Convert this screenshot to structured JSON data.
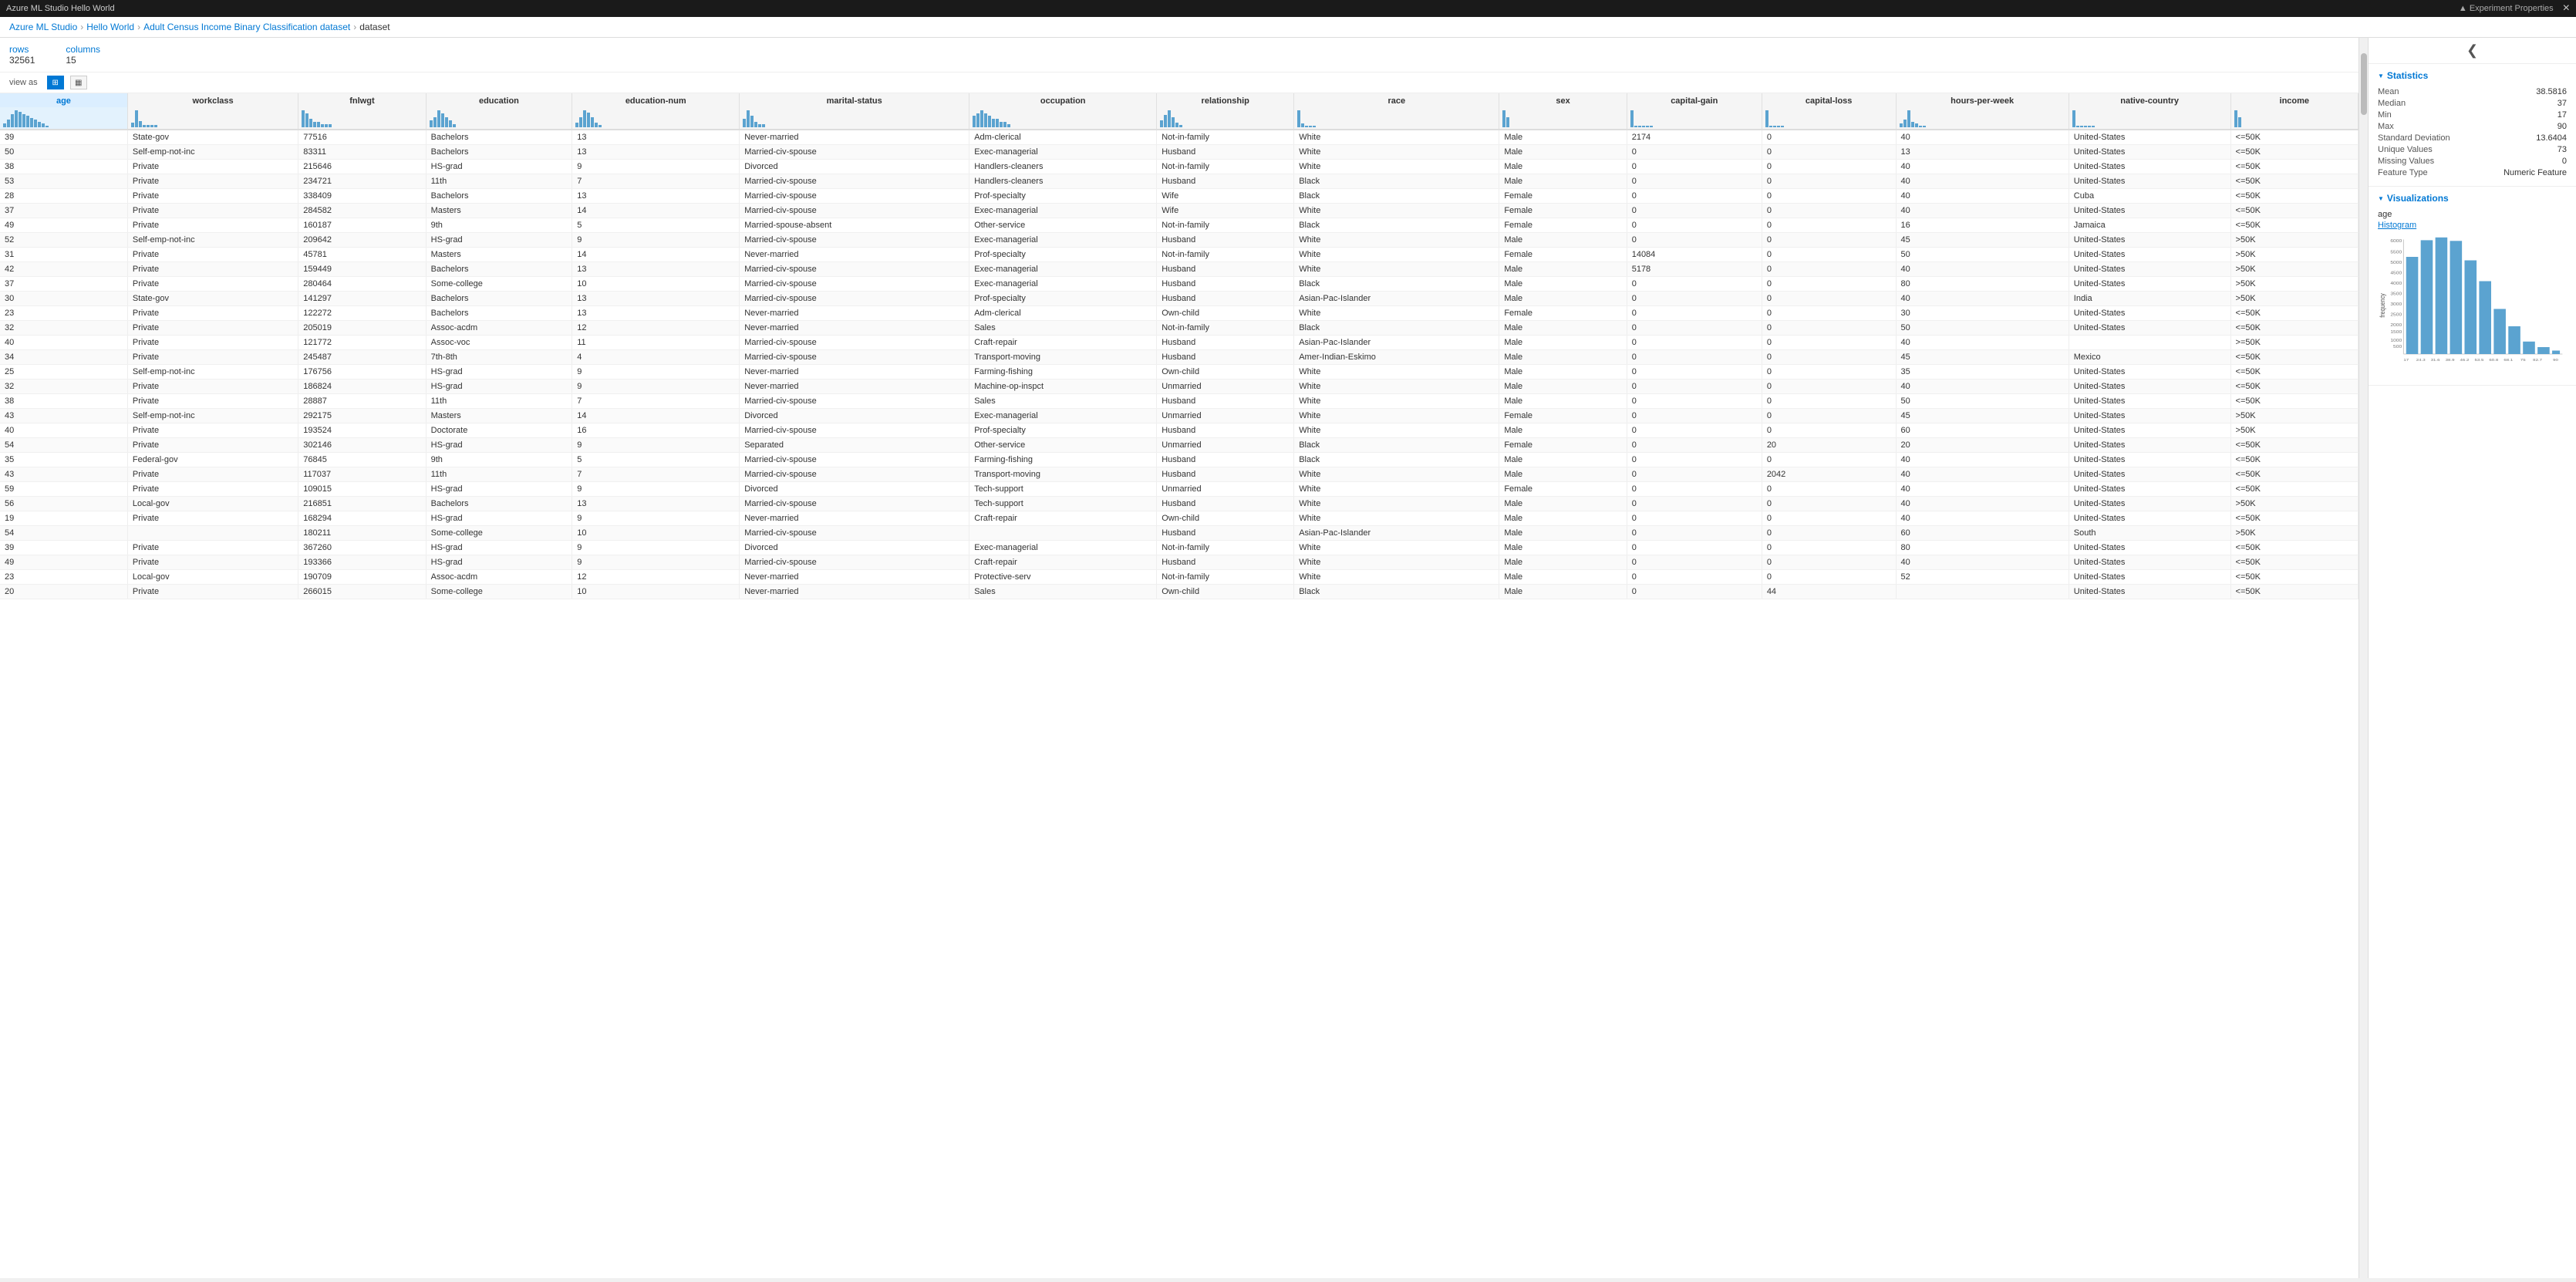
{
  "topBar": {
    "title": "Azure ML Studio  Hello World",
    "closeLabel": "×",
    "experimentProperties": "▲ Experiment Properties"
  },
  "breadcrumb": {
    "items": [
      "Azure ML Studio",
      "Hello World",
      "Adult Census Income Binary Classification dataset",
      "dataset"
    ]
  },
  "meta": {
    "rowsLabel": "rows",
    "rowsValue": "32561",
    "colsLabel": "columns",
    "colsValue": "15"
  },
  "tableControls": {
    "viewAsLabel": "view as",
    "gridIcon": "⊞",
    "chartIcon": "⬛"
  },
  "columns": [
    {
      "key": "age",
      "label": "age",
      "highlighted": true,
      "histBars": [
        2,
        4,
        7,
        9,
        8,
        7,
        6,
        5,
        4,
        3,
        2,
        1
      ]
    },
    {
      "key": "workclass",
      "label": "workclass",
      "highlighted": false,
      "histBars": [
        2,
        8,
        3,
        1,
        1,
        1,
        1
      ]
    },
    {
      "key": "fnlwgt",
      "label": "fnlwgt",
      "highlighted": false,
      "histBars": [
        6,
        5,
        3,
        2,
        2,
        1,
        1,
        1
      ]
    },
    {
      "key": "education",
      "label": "education",
      "highlighted": false,
      "histBars": [
        2,
        3,
        5,
        4,
        3,
        2,
        1
      ]
    },
    {
      "key": "education-num",
      "label": "education-num",
      "highlighted": false,
      "histBars": [
        2,
        4,
        7,
        6,
        4,
        2,
        1
      ]
    },
    {
      "key": "marital-status",
      "label": "marital-status",
      "highlighted": false,
      "histBars": [
        3,
        6,
        4,
        2,
        1,
        1
      ]
    },
    {
      "key": "occupation",
      "label": "occupation",
      "highlighted": false,
      "histBars": [
        4,
        5,
        6,
        5,
        4,
        3,
        3,
        2,
        2,
        1
      ]
    },
    {
      "key": "relationship",
      "label": "relationship",
      "highlighted": false,
      "histBars": [
        3,
        5,
        7,
        4,
        2,
        1
      ]
    },
    {
      "key": "race",
      "label": "race",
      "highlighted": false,
      "histBars": [
        9,
        2,
        1,
        1,
        1
      ]
    },
    {
      "key": "sex",
      "label": "sex",
      "highlighted": false,
      "histBars": [
        7,
        4
      ]
    },
    {
      "key": "capital-gain",
      "label": "capital-gain",
      "highlighted": false,
      "histBars": [
        10,
        1,
        1,
        1,
        1,
        1
      ]
    },
    {
      "key": "capital-loss",
      "label": "capital-loss",
      "highlighted": false,
      "histBars": [
        10,
        1,
        1,
        1,
        1
      ]
    },
    {
      "key": "hours-per-week",
      "label": "hours-per-week",
      "highlighted": false,
      "histBars": [
        2,
        4,
        9,
        3,
        2,
        1,
        1
      ]
    },
    {
      "key": "native-country",
      "label": "native-country",
      "highlighted": false,
      "histBars": [
        9,
        1,
        1,
        1,
        1,
        1
      ]
    },
    {
      "key": "income",
      "label": "income",
      "highlighted": false,
      "histBars": [
        7,
        4
      ]
    }
  ],
  "rows": [
    [
      39,
      "State-gov",
      77516,
      "Bachelors",
      13,
      "Never-married",
      "Adm-clerical",
      "Not-in-family",
      "White",
      "Male",
      2174,
      0,
      40,
      "United-States",
      "<=50K"
    ],
    [
      50,
      "Self-emp-not-inc",
      83311,
      "Bachelors",
      13,
      "Married-civ-spouse",
      "Exec-managerial",
      "Husband",
      "White",
      "Male",
      0,
      0,
      13,
      "United-States",
      "<=50K"
    ],
    [
      38,
      "Private",
      215646,
      "HS-grad",
      9,
      "Divorced",
      "Handlers-cleaners",
      "Not-in-family",
      "White",
      "Male",
      0,
      0,
      40,
      "United-States",
      "<=50K"
    ],
    [
      53,
      "Private",
      234721,
      "11th",
      7,
      "Married-civ-spouse",
      "Handlers-cleaners",
      "Husband",
      "Black",
      "Male",
      0,
      0,
      40,
      "United-States",
      "<=50K"
    ],
    [
      28,
      "Private",
      338409,
      "Bachelors",
      13,
      "Married-civ-spouse",
      "Prof-specialty",
      "Wife",
      "Black",
      "Female",
      0,
      0,
      40,
      "Cuba",
      "<=50K"
    ],
    [
      37,
      "Private",
      284582,
      "Masters",
      14,
      "Married-civ-spouse",
      "Exec-managerial",
      "Wife",
      "White",
      "Female",
      0,
      0,
      40,
      "United-States",
      "<=50K"
    ],
    [
      49,
      "Private",
      160187,
      "9th",
      5,
      "Married-spouse-absent",
      "Other-service",
      "Not-in-family",
      "Black",
      "Female",
      0,
      0,
      16,
      "Jamaica",
      "<=50K"
    ],
    [
      52,
      "Self-emp-not-inc",
      209642,
      "HS-grad",
      9,
      "Married-civ-spouse",
      "Exec-managerial",
      "Husband",
      "White",
      "Male",
      0,
      0,
      45,
      "United-States",
      ">50K"
    ],
    [
      31,
      "Private",
      45781,
      "Masters",
      14,
      "Never-married",
      "Prof-specialty",
      "Not-in-family",
      "White",
      "Female",
      14084,
      0,
      50,
      "United-States",
      ">50K"
    ],
    [
      42,
      "Private",
      159449,
      "Bachelors",
      13,
      "Married-civ-spouse",
      "Exec-managerial",
      "Husband",
      "White",
      "Male",
      5178,
      0,
      40,
      "United-States",
      ">50K"
    ],
    [
      37,
      "Private",
      280464,
      "Some-college",
      10,
      "Married-civ-spouse",
      "Exec-managerial",
      "Husband",
      "Black",
      "Male",
      0,
      0,
      80,
      "United-States",
      ">50K"
    ],
    [
      30,
      "State-gov",
      141297,
      "Bachelors",
      13,
      "Married-civ-spouse",
      "Prof-specialty",
      "Husband",
      "Asian-Pac-Islander",
      "Male",
      0,
      0,
      40,
      "India",
      ">50K"
    ],
    [
      23,
      "Private",
      122272,
      "Bachelors",
      13,
      "Never-married",
      "Adm-clerical",
      "Own-child",
      "White",
      "Female",
      0,
      0,
      30,
      "United-States",
      "<=50K"
    ],
    [
      32,
      "Private",
      205019,
      "Assoc-acdm",
      12,
      "Never-married",
      "Sales",
      "Not-in-family",
      "Black",
      "Male",
      0,
      0,
      50,
      "United-States",
      "<=50K"
    ],
    [
      40,
      "Private",
      121772,
      "Assoc-voc",
      11,
      "Married-civ-spouse",
      "Craft-repair",
      "Husband",
      "Asian-Pac-Islander",
      "Male",
      0,
      0,
      40,
      "",
      ">=50K"
    ],
    [
      34,
      "Private",
      245487,
      "7th-8th",
      4,
      "Married-civ-spouse",
      "Transport-moving",
      "Husband",
      "Amer-Indian-Eskimo",
      "Male",
      0,
      0,
      45,
      "Mexico",
      "<=50K"
    ],
    [
      25,
      "Self-emp-not-inc",
      176756,
      "HS-grad",
      9,
      "Never-married",
      "Farming-fishing",
      "Own-child",
      "White",
      "Male",
      0,
      0,
      35,
      "United-States",
      "<=50K"
    ],
    [
      32,
      "Private",
      186824,
      "HS-grad",
      9,
      "Never-married",
      "Machine-op-inspct",
      "Unmarried",
      "White",
      "Male",
      0,
      0,
      40,
      "United-States",
      "<=50K"
    ],
    [
      38,
      "Private",
      28887,
      "11th",
      7,
      "Married-civ-spouse",
      "Sales",
      "Husband",
      "White",
      "Male",
      0,
      0,
      50,
      "United-States",
      "<=50K"
    ],
    [
      43,
      "Self-emp-not-inc",
      292175,
      "Masters",
      14,
      "Divorced",
      "Exec-managerial",
      "Unmarried",
      "White",
      "Female",
      0,
      0,
      45,
      "United-States",
      ">50K"
    ],
    [
      40,
      "Private",
      193524,
      "Doctorate",
      16,
      "Married-civ-spouse",
      "Prof-specialty",
      "Husband",
      "White",
      "Male",
      0,
      0,
      60,
      "United-States",
      ">50K"
    ],
    [
      54,
      "Private",
      302146,
      "HS-grad",
      9,
      "Separated",
      "Other-service",
      "Unmarried",
      "Black",
      "Female",
      0,
      20,
      20,
      "United-States",
      "<=50K"
    ],
    [
      35,
      "Federal-gov",
      76845,
      "9th",
      5,
      "Married-civ-spouse",
      "Farming-fishing",
      "Husband",
      "Black",
      "Male",
      0,
      0,
      40,
      "United-States",
      "<=50K"
    ],
    [
      43,
      "Private",
      117037,
      "11th",
      7,
      "Married-civ-spouse",
      "Transport-moving",
      "Husband",
      "White",
      "Male",
      0,
      2042,
      40,
      "United-States",
      "<=50K"
    ],
    [
      59,
      "Private",
      109015,
      "HS-grad",
      9,
      "Divorced",
      "Tech-support",
      "Unmarried",
      "White",
      "Female",
      0,
      0,
      40,
      "United-States",
      "<=50K"
    ],
    [
      56,
      "Local-gov",
      216851,
      "Bachelors",
      13,
      "Married-civ-spouse",
      "Tech-support",
      "Husband",
      "White",
      "Male",
      0,
      0,
      40,
      "United-States",
      ">50K"
    ],
    [
      19,
      "Private",
      168294,
      "HS-grad",
      9,
      "Never-married",
      "Craft-repair",
      "Own-child",
      "White",
      "Male",
      0,
      0,
      40,
      "United-States",
      "<=50K"
    ],
    [
      54,
      "",
      180211,
      "Some-college",
      10,
      "Married-civ-spouse",
      "",
      "Husband",
      "Asian-Pac-Islander",
      "Male",
      0,
      0,
      60,
      "South",
      ">50K"
    ],
    [
      39,
      "Private",
      367260,
      "HS-grad",
      9,
      "Divorced",
      "Exec-managerial",
      "Not-in-family",
      "White",
      "Male",
      0,
      0,
      80,
      "United-States",
      "<=50K"
    ],
    [
      49,
      "Private",
      193366,
      "HS-grad",
      9,
      "Married-civ-spouse",
      "Craft-repair",
      "Husband",
      "White",
      "Male",
      0,
      0,
      40,
      "United-States",
      "<=50K"
    ],
    [
      23,
      "Local-gov",
      190709,
      "Assoc-acdm",
      12,
      "Never-married",
      "Protective-serv",
      "Not-in-family",
      "White",
      "Male",
      0,
      0,
      52,
      "United-States",
      "<=50K"
    ],
    [
      20,
      "Private",
      266015,
      "Some-college",
      10,
      "Never-married",
      "Sales",
      "Own-child",
      "Black",
      "Male",
      0,
      44,
      "",
      "United-States",
      "<=50K"
    ]
  ],
  "statistics": {
    "sectionTitle": "Statistics",
    "items": [
      {
        "label": "Mean",
        "value": "38.5816"
      },
      {
        "label": "Median",
        "value": "37"
      },
      {
        "label": "Min",
        "value": "17"
      },
      {
        "label": "Max",
        "value": "90"
      },
      {
        "label": "Standard Deviation",
        "value": "13.6404"
      },
      {
        "label": "Unique Values",
        "value": "73"
      },
      {
        "label": "Missing Values",
        "value": "0"
      },
      {
        "label": "Feature Type",
        "value": "Numeric Feature"
      }
    ]
  },
  "visualizations": {
    "sectionTitle": "Visualizations",
    "fieldName": "age",
    "chartType": "Histogram",
    "histogram": {
      "bars": [
        {
          "label": "17",
          "height": 140
        },
        {
          "label": "24.3",
          "height": 170
        },
        {
          "label": "31.6",
          "height": 185
        },
        {
          "label": "38.9",
          "height": 180
        },
        {
          "label": "46.2",
          "height": 140
        },
        {
          "label": "53.5",
          "height": 100
        },
        {
          "label": "60.8",
          "height": 65
        },
        {
          "label": "68.1",
          "height": 35
        },
        {
          "label": "75.4",
          "height": 15
        },
        {
          "label": "82.7",
          "height": 7
        },
        {
          "label": "90",
          "height": 4
        }
      ],
      "yLabels": [
        "6000",
        "5500",
        "5000",
        "4500",
        "4000",
        "3500",
        "3000",
        "2500",
        "2000",
        "1500",
        "1000",
        "500",
        "0"
      ],
      "yAxisLabel": "frequency",
      "xAxisLabel": "age"
    }
  }
}
